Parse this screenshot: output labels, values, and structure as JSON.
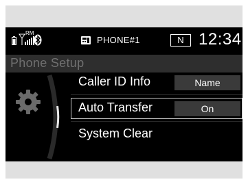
{
  "status_bar": {
    "roaming_label": "RM",
    "phone_name": "PHONE#1",
    "gear_indicator": "N",
    "clock": "12:34"
  },
  "header": {
    "title": "Phone Setup"
  },
  "menu": {
    "items": [
      {
        "label": "Caller ID Info",
        "value": "Name"
      },
      {
        "label": "Auto Transfer",
        "value": "On",
        "selected": true
      },
      {
        "label": "System Clear",
        "value": ""
      }
    ]
  },
  "colors": {
    "screen_bg": "#000000",
    "header_bg": "#2e2e2e",
    "text": "#ffffff",
    "header_text": "#707070"
  }
}
